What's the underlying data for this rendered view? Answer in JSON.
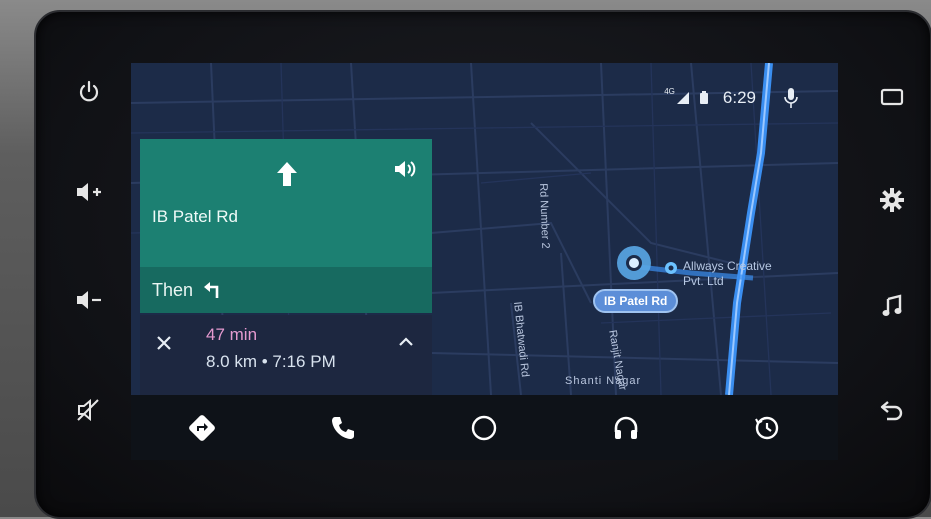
{
  "status_bar": {
    "signal_label": "4G",
    "time": "6:29"
  },
  "navigation": {
    "street": "IB Patel Rd",
    "then_label": "Then",
    "eta": {
      "duration": "47 min",
      "details": "8.0 km • 7:16 PM"
    }
  },
  "map": {
    "current_location_label": "IB Patel Rd",
    "poi_name_line1": "Allways Creative",
    "poi_name_line2": "Pvt. Ltd",
    "road_labels": [
      "Rd Number 2",
      "IB Bhatwadi Rd",
      "Shanti Nagar",
      "Ranjit Nagar"
    ]
  },
  "colors": {
    "turn_card": "#1c8072",
    "eta_panel": "#1d2740",
    "map_bg": "#1c2b48",
    "route": "#3a8ef0",
    "eta_time": "#e59ad0"
  },
  "icons": {
    "hw_left": [
      "power-icon",
      "volume-up-icon",
      "volume-down-icon",
      "mute-icon"
    ],
    "hw_right": [
      "screen-icon",
      "settings-icon",
      "music-icon",
      "back-icon"
    ],
    "bottom_bar": [
      "navigation-icon",
      "phone-icon",
      "home-icon",
      "headphones-icon",
      "recents-icon"
    ]
  }
}
